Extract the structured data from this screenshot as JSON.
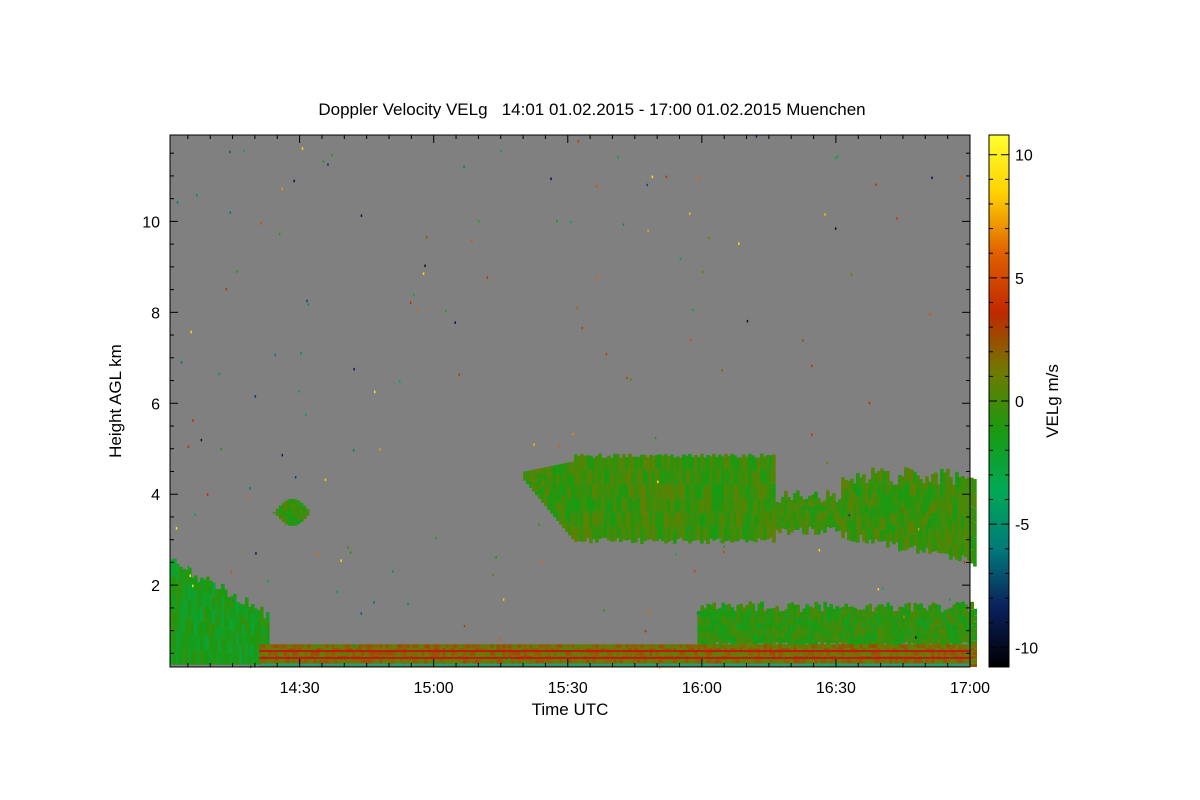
{
  "chart_data": {
    "type": "heatmap",
    "title": "Doppler Velocity VELg   14:01 01.02.2015 - 17:00 01.02.2015 Muenchen",
    "xlabel": "Time UTC",
    "ylabel": "Height AGL km",
    "xlim": [
      "14:01",
      "17:00"
    ],
    "ylim": [
      0.2,
      11.9
    ],
    "xticks": [
      {
        "label": "14:30",
        "minutes": 30
      },
      {
        "label": "15:00",
        "minutes": 60
      },
      {
        "label": "15:30",
        "minutes": 90
      },
      {
        "label": "16:00",
        "minutes": 120
      },
      {
        "label": "16:30",
        "minutes": 150
      },
      {
        "label": "17:00",
        "minutes": 180
      }
    ],
    "yticks": [
      2,
      4,
      6,
      8,
      10
    ],
    "grid": false,
    "background_color": "#808080",
    "colorbar": {
      "label": "VELg m/s",
      "range": [
        -10.8,
        10.8
      ],
      "ticks": [
        "10",
        "5",
        "0",
        "-5",
        "-10"
      ],
      "tick_values": [
        10,
        5,
        0,
        -5,
        -10
      ],
      "colors": [
        "#000000",
        "#0a1f5c",
        "#007a7a",
        "#00aa55",
        "#1a9a10",
        "#6f7a00",
        "#c02800",
        "#e06000",
        "#ffd000",
        "#ffff30"
      ]
    },
    "echo_regions": [
      {
        "name": "low cloud/precip",
        "t_start": 0,
        "t_end": 22,
        "h_min": 0.25,
        "h_max": 2.4,
        "velocity": -1.5
      },
      {
        "name": "small cell",
        "t_start": 23,
        "t_end": 31,
        "h_min": 3.3,
        "h_max": 3.9,
        "velocity": -0.5
      },
      {
        "name": "mid-level cloud",
        "t_start": 79,
        "t_end": 180,
        "h_min": 2.3,
        "h_max": 4.9,
        "velocity": -0.3
      },
      {
        "name": "boundary layer band",
        "t_start": 118,
        "t_end": 180,
        "h_min": 0.5,
        "h_max": 1.7,
        "velocity": -0.7
      },
      {
        "name": "surface layers",
        "t_start": 20,
        "t_end": 180,
        "h_min": 0.2,
        "h_max": 0.7,
        "velocity": 1.5
      }
    ]
  }
}
